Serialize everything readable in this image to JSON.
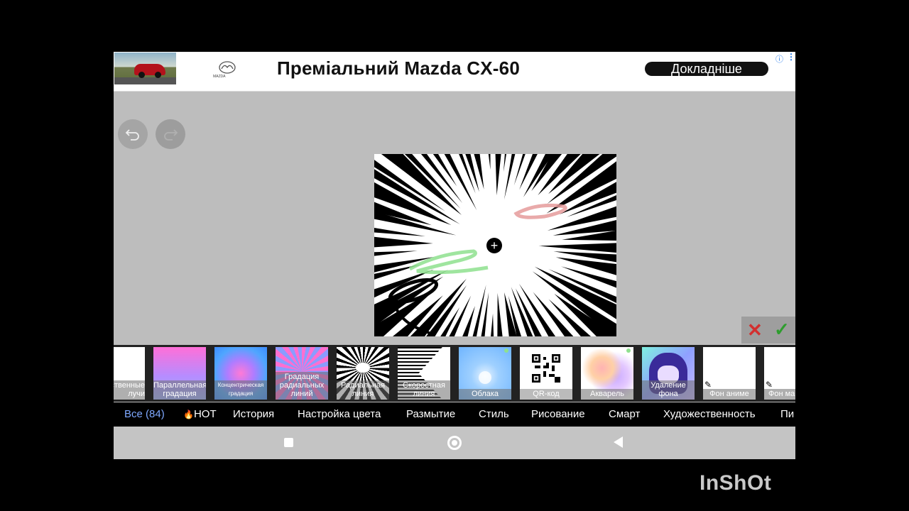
{
  "ad": {
    "title": "Преміальний Mazda CX-60",
    "cta": "Докладніше",
    "logo_text": "MAZDA",
    "info_icon": "info-icon",
    "menu_icon": "more-vertical-icon"
  },
  "toolbar": {
    "undo_icon": "undo-icon",
    "redo_icon": "redo-icon"
  },
  "confirm": {
    "cancel_icon": "close-icon",
    "apply_icon": "check-icon"
  },
  "effects": [
    {
      "label": "ственные лучи"
    },
    {
      "label": "Параллельная градация"
    },
    {
      "label": "Концентрическая градация"
    },
    {
      "label": "Градация радиальных линий"
    },
    {
      "label": "Радиальная линия",
      "selected": true
    },
    {
      "label": "Скоростная линия"
    },
    {
      "label": "Облака"
    },
    {
      "label": "QR-код"
    },
    {
      "label": "Акварель"
    },
    {
      "label": "Удаление фона"
    },
    {
      "label": "Фон аниме"
    },
    {
      "label": "Фон ма"
    }
  ],
  "categories": [
    {
      "label": "Все (84)",
      "active": true
    },
    {
      "label": "HOT"
    },
    {
      "label": "История"
    },
    {
      "label": "Настройка цвета"
    },
    {
      "label": "Размытие"
    },
    {
      "label": "Стиль"
    },
    {
      "label": "Рисование"
    },
    {
      "label": "Смарт"
    },
    {
      "label": "Художественность"
    },
    {
      "label": "Пи"
    }
  ],
  "watermark": "InShOt",
  "colors": {
    "accent": "#7ea8ff",
    "selected_outline": "#5bb4ff",
    "cancel": "#d32f2f",
    "apply": "#2e9d2e"
  }
}
